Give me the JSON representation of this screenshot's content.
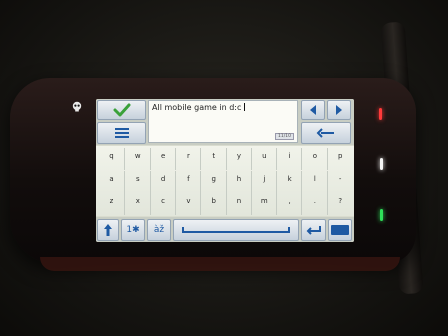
{
  "screen": {
    "text_value": "All mobile game in d:c",
    "char_counter": "11/10",
    "rows": [
      [
        "q",
        "w",
        "e",
        "r",
        "t",
        "y",
        "u",
        "i",
        "o",
        "p"
      ],
      [
        "a",
        "s",
        "d",
        "f",
        "g",
        "h",
        "j",
        "k",
        "l",
        "-"
      ],
      [
        "z",
        "x",
        "c",
        "v",
        "b",
        "n",
        "m",
        ",",
        ".",
        "?"
      ]
    ],
    "numeric_mode_label": "1✱",
    "language_mode_label": "àž"
  },
  "colors": {
    "accent_check": "#3aa13a",
    "led_red": "#ff3a3a",
    "led_white": "#f4f4f4",
    "led_green": "#2fe05a",
    "key_blue": "#1f5aa3"
  }
}
